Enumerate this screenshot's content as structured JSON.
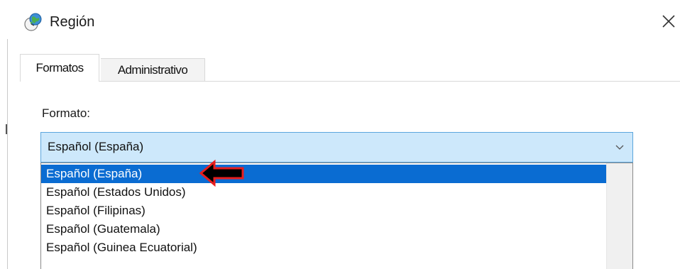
{
  "window": {
    "title": "Región",
    "title_icon": "globe-clock-icon",
    "close_icon": "close-icon"
  },
  "tabs": [
    {
      "label": "Formatos",
      "active": true
    },
    {
      "label": "Administrativo",
      "active": false
    }
  ],
  "format": {
    "label": "Formato:",
    "selected": "Español (España)",
    "chevron_icon": "chevron-down-icon",
    "options": [
      {
        "label": "Español (España)",
        "highlighted": true
      },
      {
        "label": "Español (Estados Unidos)",
        "highlighted": false
      },
      {
        "label": "Español (Filipinas)",
        "highlighted": false
      },
      {
        "label": "Español (Guatemala)",
        "highlighted": false
      },
      {
        "label": "Español (Guinea Ecuatorial)",
        "highlighted": false
      }
    ]
  },
  "annotation": {
    "type": "arrow-left",
    "color": "#000000",
    "outline": "#e81e1e"
  },
  "colors": {
    "combo_bg": "#cde8fb",
    "combo_border": "#5ba6dd",
    "selection": "#0a6cd2"
  }
}
